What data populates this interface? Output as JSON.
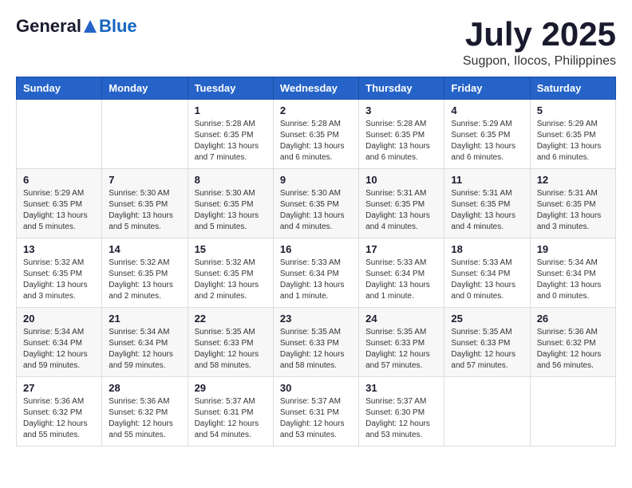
{
  "header": {
    "logo_general": "General",
    "logo_blue": "Blue",
    "month": "July 2025",
    "location": "Sugpon, Ilocos, Philippines"
  },
  "weekdays": [
    "Sunday",
    "Monday",
    "Tuesday",
    "Wednesday",
    "Thursday",
    "Friday",
    "Saturday"
  ],
  "weeks": [
    [
      {
        "day": "",
        "info": ""
      },
      {
        "day": "",
        "info": ""
      },
      {
        "day": "1",
        "info": "Sunrise: 5:28 AM\nSunset: 6:35 PM\nDaylight: 13 hours\nand 7 minutes."
      },
      {
        "day": "2",
        "info": "Sunrise: 5:28 AM\nSunset: 6:35 PM\nDaylight: 13 hours\nand 6 minutes."
      },
      {
        "day": "3",
        "info": "Sunrise: 5:28 AM\nSunset: 6:35 PM\nDaylight: 13 hours\nand 6 minutes."
      },
      {
        "day": "4",
        "info": "Sunrise: 5:29 AM\nSunset: 6:35 PM\nDaylight: 13 hours\nand 6 minutes."
      },
      {
        "day": "5",
        "info": "Sunrise: 5:29 AM\nSunset: 6:35 PM\nDaylight: 13 hours\nand 6 minutes."
      }
    ],
    [
      {
        "day": "6",
        "info": "Sunrise: 5:29 AM\nSunset: 6:35 PM\nDaylight: 13 hours\nand 5 minutes."
      },
      {
        "day": "7",
        "info": "Sunrise: 5:30 AM\nSunset: 6:35 PM\nDaylight: 13 hours\nand 5 minutes."
      },
      {
        "day": "8",
        "info": "Sunrise: 5:30 AM\nSunset: 6:35 PM\nDaylight: 13 hours\nand 5 minutes."
      },
      {
        "day": "9",
        "info": "Sunrise: 5:30 AM\nSunset: 6:35 PM\nDaylight: 13 hours\nand 4 minutes."
      },
      {
        "day": "10",
        "info": "Sunrise: 5:31 AM\nSunset: 6:35 PM\nDaylight: 13 hours\nand 4 minutes."
      },
      {
        "day": "11",
        "info": "Sunrise: 5:31 AM\nSunset: 6:35 PM\nDaylight: 13 hours\nand 4 minutes."
      },
      {
        "day": "12",
        "info": "Sunrise: 5:31 AM\nSunset: 6:35 PM\nDaylight: 13 hours\nand 3 minutes."
      }
    ],
    [
      {
        "day": "13",
        "info": "Sunrise: 5:32 AM\nSunset: 6:35 PM\nDaylight: 13 hours\nand 3 minutes."
      },
      {
        "day": "14",
        "info": "Sunrise: 5:32 AM\nSunset: 6:35 PM\nDaylight: 13 hours\nand 2 minutes."
      },
      {
        "day": "15",
        "info": "Sunrise: 5:32 AM\nSunset: 6:35 PM\nDaylight: 13 hours\nand 2 minutes."
      },
      {
        "day": "16",
        "info": "Sunrise: 5:33 AM\nSunset: 6:34 PM\nDaylight: 13 hours\nand 1 minute."
      },
      {
        "day": "17",
        "info": "Sunrise: 5:33 AM\nSunset: 6:34 PM\nDaylight: 13 hours\nand 1 minute."
      },
      {
        "day": "18",
        "info": "Sunrise: 5:33 AM\nSunset: 6:34 PM\nDaylight: 13 hours\nand 0 minutes."
      },
      {
        "day": "19",
        "info": "Sunrise: 5:34 AM\nSunset: 6:34 PM\nDaylight: 13 hours\nand 0 minutes."
      }
    ],
    [
      {
        "day": "20",
        "info": "Sunrise: 5:34 AM\nSunset: 6:34 PM\nDaylight: 12 hours\nand 59 minutes."
      },
      {
        "day": "21",
        "info": "Sunrise: 5:34 AM\nSunset: 6:34 PM\nDaylight: 12 hours\nand 59 minutes."
      },
      {
        "day": "22",
        "info": "Sunrise: 5:35 AM\nSunset: 6:33 PM\nDaylight: 12 hours\nand 58 minutes."
      },
      {
        "day": "23",
        "info": "Sunrise: 5:35 AM\nSunset: 6:33 PM\nDaylight: 12 hours\nand 58 minutes."
      },
      {
        "day": "24",
        "info": "Sunrise: 5:35 AM\nSunset: 6:33 PM\nDaylight: 12 hours\nand 57 minutes."
      },
      {
        "day": "25",
        "info": "Sunrise: 5:35 AM\nSunset: 6:33 PM\nDaylight: 12 hours\nand 57 minutes."
      },
      {
        "day": "26",
        "info": "Sunrise: 5:36 AM\nSunset: 6:32 PM\nDaylight: 12 hours\nand 56 minutes."
      }
    ],
    [
      {
        "day": "27",
        "info": "Sunrise: 5:36 AM\nSunset: 6:32 PM\nDaylight: 12 hours\nand 55 minutes."
      },
      {
        "day": "28",
        "info": "Sunrise: 5:36 AM\nSunset: 6:32 PM\nDaylight: 12 hours\nand 55 minutes."
      },
      {
        "day": "29",
        "info": "Sunrise: 5:37 AM\nSunset: 6:31 PM\nDaylight: 12 hours\nand 54 minutes."
      },
      {
        "day": "30",
        "info": "Sunrise: 5:37 AM\nSunset: 6:31 PM\nDaylight: 12 hours\nand 53 minutes."
      },
      {
        "day": "31",
        "info": "Sunrise: 5:37 AM\nSunset: 6:30 PM\nDaylight: 12 hours\nand 53 minutes."
      },
      {
        "day": "",
        "info": ""
      },
      {
        "day": "",
        "info": ""
      }
    ]
  ]
}
